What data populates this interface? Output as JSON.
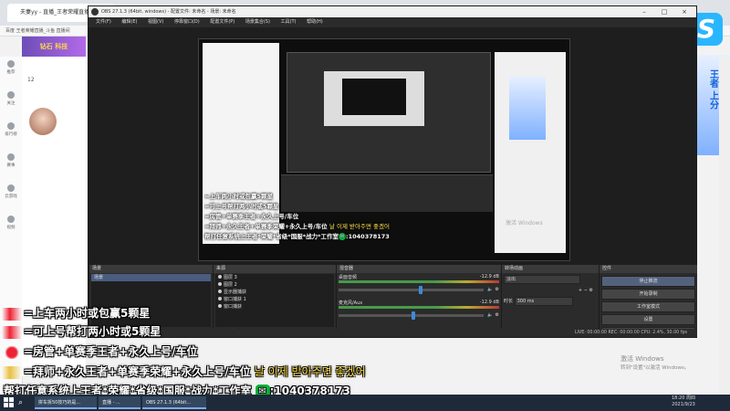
{
  "browser": {
    "tab_title": "夫妻yy - 直播_王者荣耀直播_斗鱼",
    "bookmarks": "百度   王者荣耀直播_斗鱼   直播间",
    "banner_text": "钻石 科技",
    "number_text": "12",
    "sidebar": [
      {
        "label": "推荐"
      },
      {
        "label": "关注"
      },
      {
        "label": "排行榜"
      },
      {
        "label": "赛事"
      },
      {
        "label": "云游戏"
      },
      {
        "label": "视频"
      }
    ],
    "ad_text": "王者 上分",
    "logo_letter": "S"
  },
  "obs": {
    "title": "OBS 27.1.3 (64bit, windows) - 配置文件: 未命名 - 场景: 未命名",
    "menu": [
      "文件(F)",
      "编辑(E)",
      "视图(V)",
      "停靠窗口(D)",
      "配置文件(P)",
      "场景集合(S)",
      "工具(T)",
      "帮助(H)"
    ],
    "docks": {
      "scenes": {
        "title": "场景",
        "items": [
          "场景"
        ]
      },
      "sources": {
        "title": "来源",
        "items": [
          "图层 3",
          "图层 2",
          "显示器捕获",
          "窗口捕获 1",
          "窗口捕获"
        ]
      },
      "mixer": {
        "title": "混音器",
        "rows": [
          {
            "name": "桌面音频",
            "db": "-12.9 dB",
            "level": 0.55
          },
          {
            "name": "麦克风/Aux",
            "db": "-12.9 dB",
            "level": 0.5
          }
        ]
      },
      "transitions": {
        "title": "转场动画",
        "type": "淡出",
        "duration_label": "时长",
        "duration": "300 ms"
      },
      "controls": {
        "title": "控件",
        "buttons": [
          "停止推流",
          "开始录制",
          "工作室模式",
          "设置",
          "退出"
        ]
      }
    },
    "status": "LIVE: 00:00:00    REC: 00:00:00    CPU: 2.4%, 30.00 fps",
    "activate": "激活 Windows",
    "activate_sub": "转到\"设置\"以激活 Windows。"
  },
  "overlay": {
    "line1": "=上车两小时或包赢5颗星",
    "line2": "=可上号帮打两小时或5颗星",
    "line3": "=房管+单赛季王者+永久上号/车位",
    "line4": "=拜师+永久王者+单赛季荣耀+永久上号/车位",
    "line4_kr": "날 이제 받아주면 좋겠어",
    "line5": "帮打任意系统上王者*荣耀*省级*国服*战力*工作室",
    "line5_wechat": ":1040378173"
  },
  "desktop": {
    "activate": "激活 Windows",
    "activate_sub": "转到\"设置\"以激活 Windows。"
  },
  "taskbar": {
    "apps": [
      "拼车拆50技巧的是...",
      "直播 - ...",
      "OBS 27.1.3 (64bit..."
    ],
    "time": "18:20 周四",
    "date": "2021/9/23"
  }
}
